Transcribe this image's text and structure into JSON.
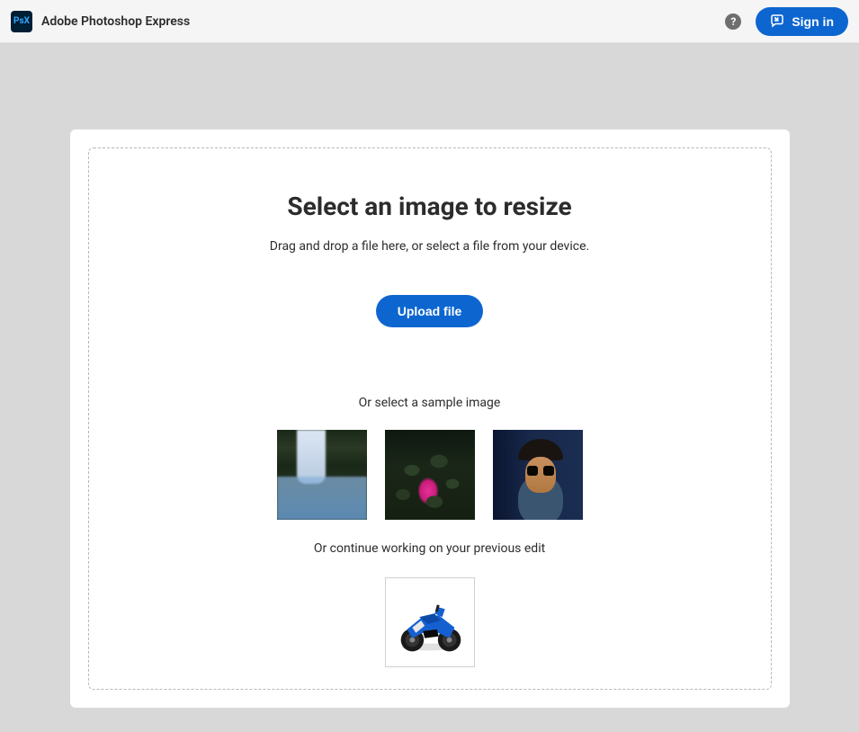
{
  "header": {
    "app_title": "Adobe Photoshop Express",
    "logo_text": "PsX",
    "help_glyph": "?",
    "signin_label": "Sign in"
  },
  "main": {
    "heading": "Select an image to resize",
    "subtitle": "Drag and drop a file here, or select a file from your device.",
    "upload_label": "Upload file",
    "sample_label": "Or select a sample image",
    "continue_label": "Or continue working on your previous edit",
    "samples": [
      {
        "name": "waterfall"
      },
      {
        "name": "pink-lotus"
      },
      {
        "name": "man-in-hat"
      }
    ],
    "previous": {
      "name": "blue-motorcycle"
    }
  },
  "colors": {
    "primary": "#0d66d0",
    "text": "#2c2c2c",
    "page_bg": "#d8d8d8",
    "card_bg": "#ffffff"
  }
}
